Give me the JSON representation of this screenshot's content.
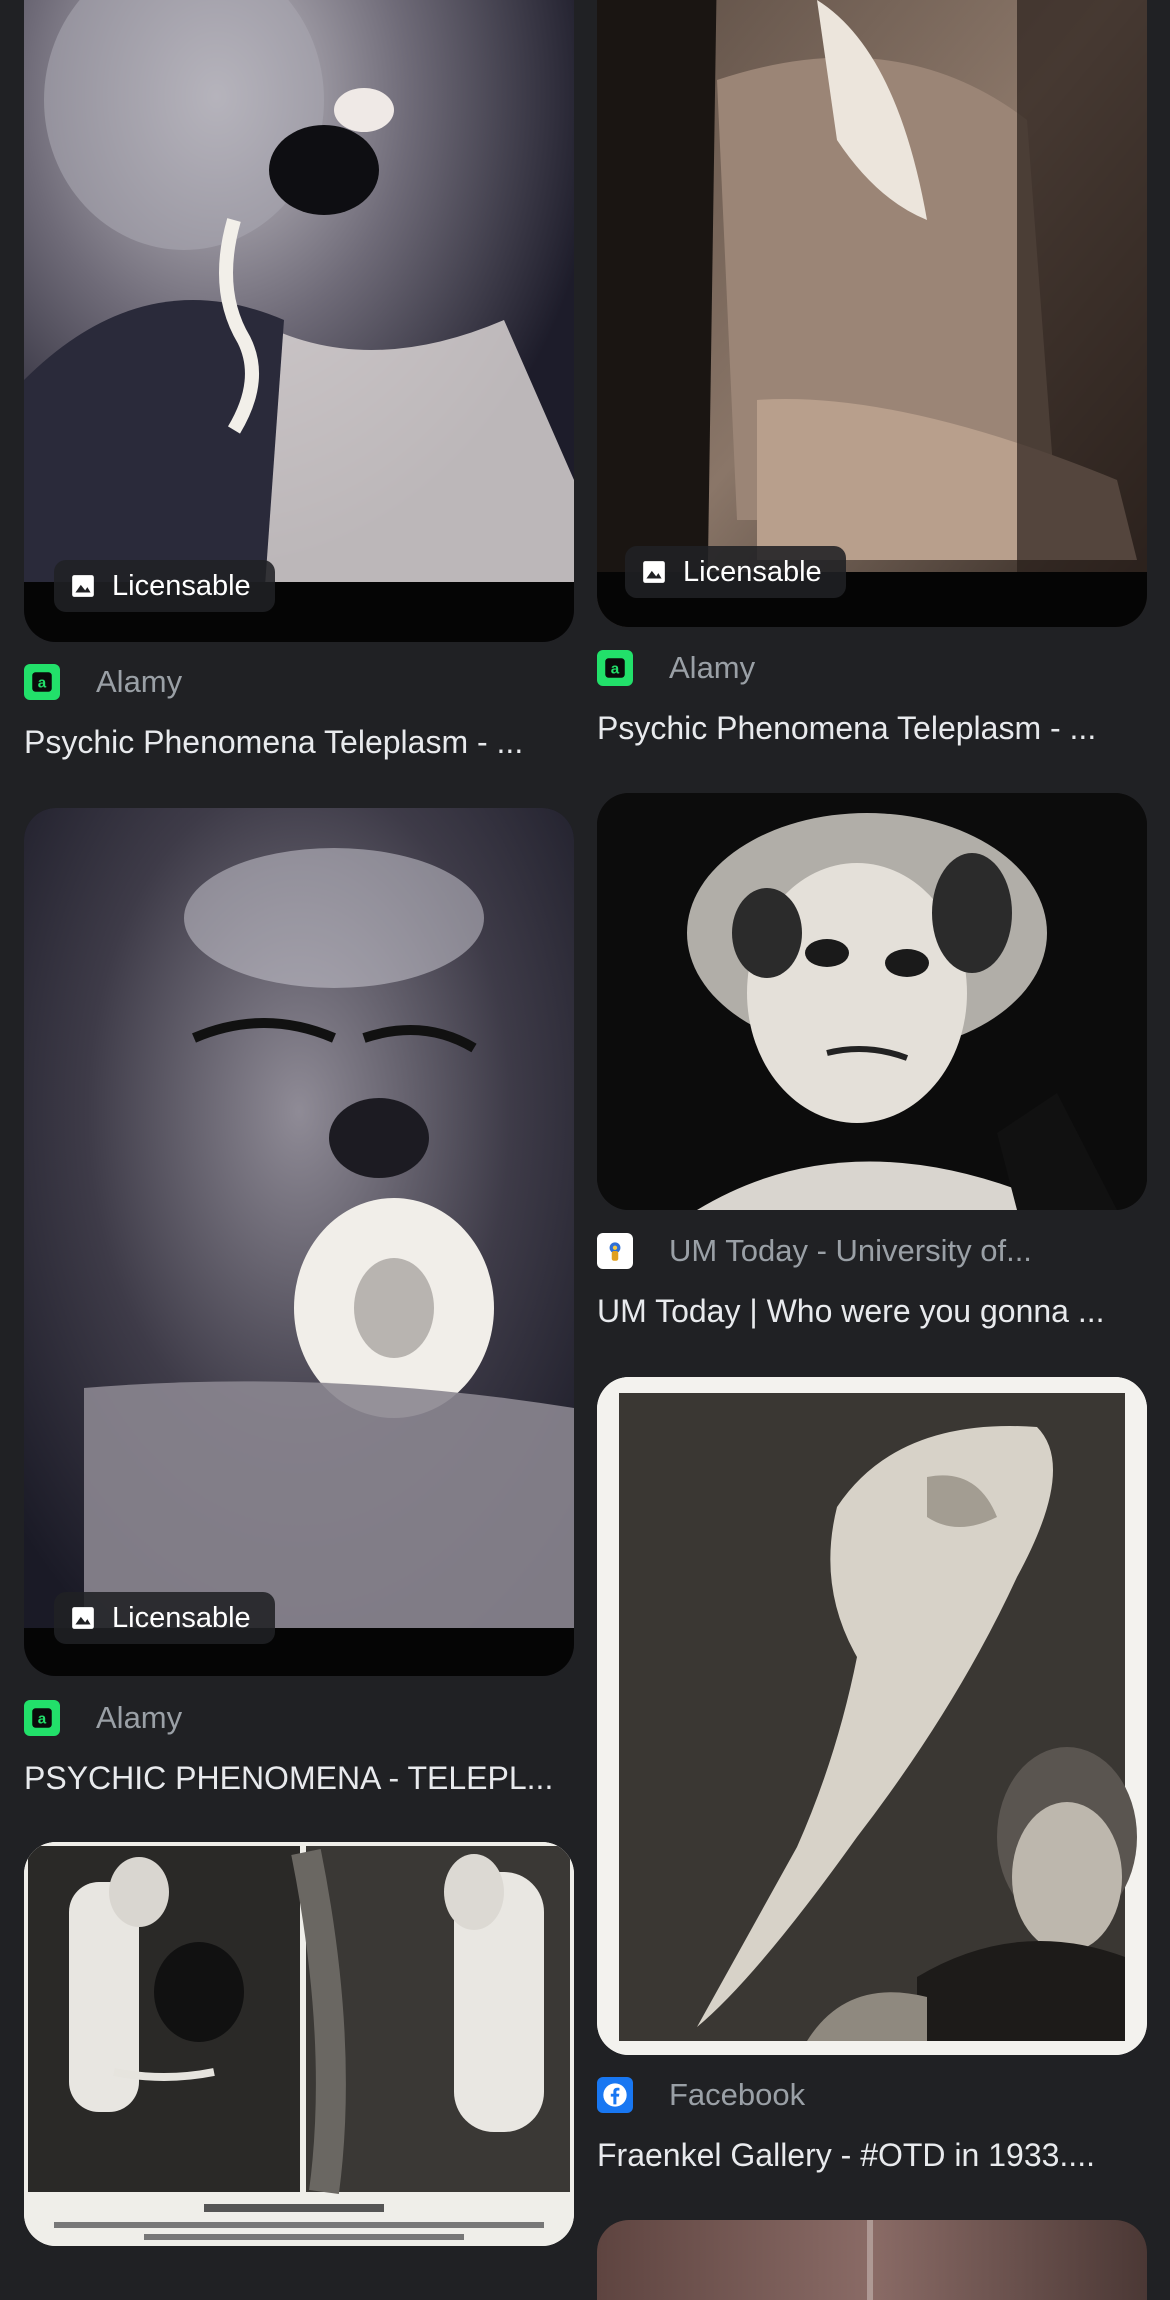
{
  "colors": {
    "background": "#202124",
    "alamy_green": "#22e06a",
    "facebook_blue": "#1877f2"
  },
  "results": [
    {
      "badge": "Licensable",
      "source": "Alamy",
      "favicon": "alamy-favicon",
      "title": "Psychic Phenomena Teleplasm - ..."
    },
    {
      "badge": "Licensable",
      "source": "Alamy",
      "favicon": "alamy-favicon",
      "title": "Psychic Phenomena Teleplasm - ..."
    },
    {
      "badge": "Licensable",
      "source": "Alamy",
      "favicon": "alamy-favicon",
      "title": "PSYCHIC PHENOMENA - TELEPL..."
    },
    {
      "source": "UM Today - University of...",
      "favicon": "um-today-favicon",
      "title": "UM Today | Who were you gonna ..."
    },
    {
      "source": "Facebook",
      "favicon": "facebook-favicon",
      "title": "Fraenkel Gallery - #OTD in 1933...."
    }
  ]
}
